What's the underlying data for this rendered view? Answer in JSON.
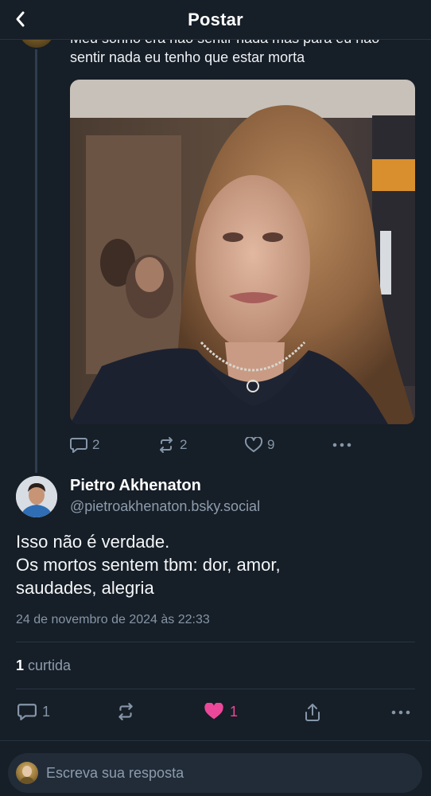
{
  "header": {
    "title": "Postar",
    "back_icon": "chevron-left-icon"
  },
  "parent_post": {
    "text": "Meu sonho era não sentir nada mas para eu não sentir nada eu tenho que estar morta",
    "actions": {
      "replies": "2",
      "reposts": "2",
      "likes": "9"
    }
  },
  "reply": {
    "author_name": "Pietro Akhenaton",
    "author_handle": "@pietroakhenaton.bsky.social",
    "text_lines": [
      "Isso não é verdade.",
      "Os mortos sentem tbm: dor, amor,",
      "saudades, alegria"
    ],
    "date": "24 de novembro de 2024 às 22:33",
    "like_count": "1",
    "like_label": "curtida",
    "actions": {
      "replies": "1",
      "likes": "1"
    }
  },
  "composer": {
    "placeholder": "Escreva sua resposta"
  },
  "colors": {
    "background": "#161e27",
    "accent_like": "#ec4899",
    "muted": "#8596a9"
  }
}
